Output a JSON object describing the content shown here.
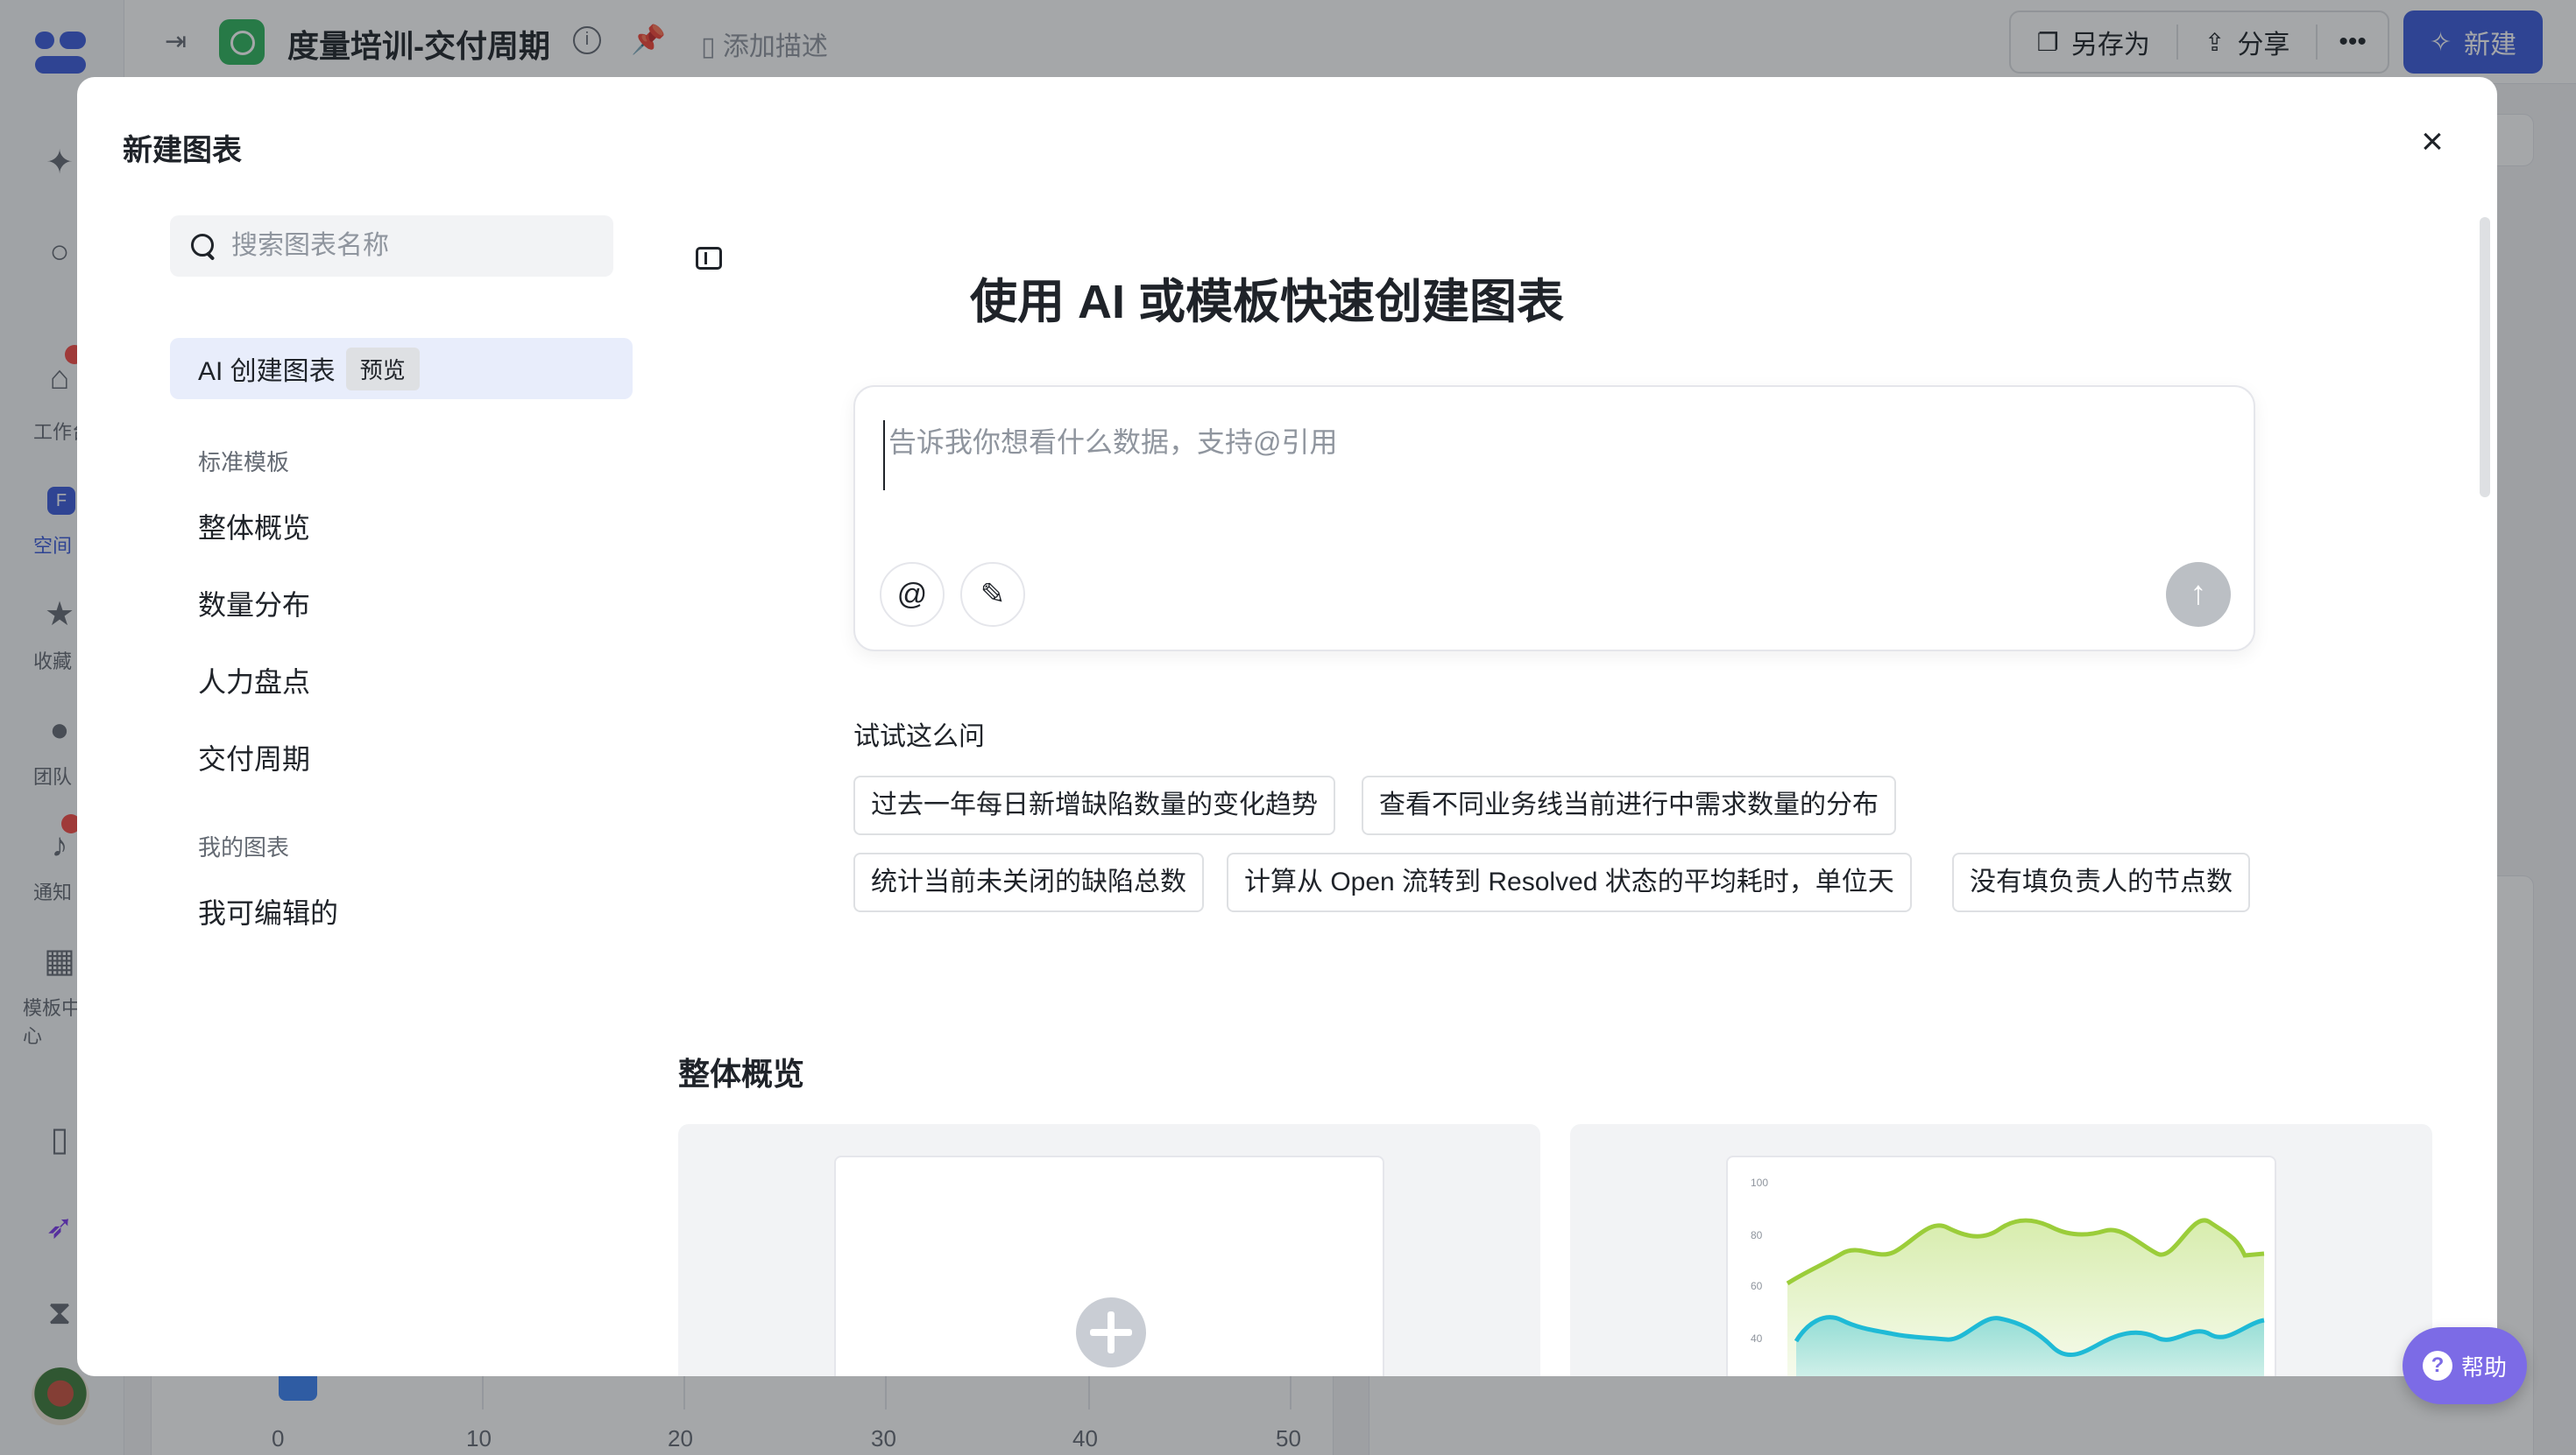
{
  "app": {
    "doc_title": "度量培训-交付周期",
    "add_description": "添加描述",
    "actions": {
      "save_as": "另存为",
      "share": "分享",
      "more": "•••",
      "new": "新建"
    },
    "sidebar": [
      {
        "label": "工作台",
        "icon": "home-icon"
      },
      {
        "label": "空间",
        "icon": "space-icon"
      },
      {
        "label": "收藏",
        "icon": "star-icon"
      },
      {
        "label": "团队",
        "icon": "team-icon"
      },
      {
        "label": "通知",
        "icon": "bell-icon"
      },
      {
        "label": "模板中心",
        "icon": "grid-icon"
      }
    ],
    "background_axis": [
      "0",
      "10",
      "20",
      "30",
      "40",
      "50"
    ]
  },
  "modal": {
    "title": "新建图表",
    "search_placeholder": "搜索图表名称",
    "ai_item": {
      "label": "AI 创建图表",
      "badge": "预览"
    },
    "groups": [
      {
        "title": "标准模板",
        "items": [
          "整体概览",
          "数量分布",
          "人力盘点",
          "交付周期"
        ]
      },
      {
        "title": "我的图表",
        "items": [
          "我可编辑的"
        ]
      }
    ],
    "heading": "使用 AI 或模板快速创建图表",
    "prompt_placeholder": "告诉我你想看什么数据，支持@引用",
    "try_label": "试试这么问",
    "suggestions": [
      "过去一年每日新增缺陷数量的变化趋势",
      "查看不同业务线当前进行中需求数量的分布",
      "统计当前未关闭的缺陷总数",
      "计算从 Open 流转到 Resolved 状态的平均耗时，单位天",
      "没有填负责人的节点数"
    ],
    "section_title": "整体概览",
    "chart_ticks": [
      "100",
      "80",
      "60",
      "40"
    ]
  },
  "help": {
    "label": "帮助"
  },
  "colors": {
    "accent": "#3b5bdb",
    "green": "#2db55d",
    "help": "#7c6be6"
  }
}
